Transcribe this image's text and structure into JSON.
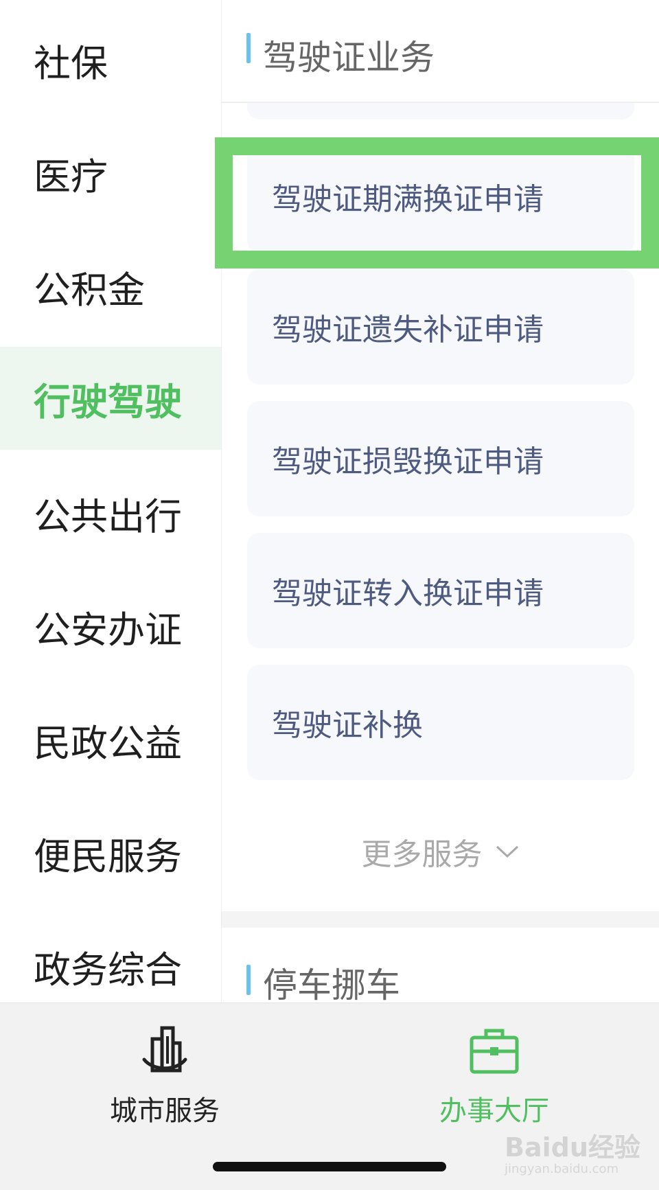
{
  "sidebar": {
    "items": [
      {
        "label": "社保"
      },
      {
        "label": "医疗"
      },
      {
        "label": "公积金"
      },
      {
        "label": "行驶驾驶"
      },
      {
        "label": "公共出行"
      },
      {
        "label": "公安办证"
      },
      {
        "label": "民政公益"
      },
      {
        "label": "便民服务"
      },
      {
        "label": "政务综合"
      }
    ],
    "active_label": "行驶驾驶"
  },
  "main": {
    "section1": {
      "title": "驾驶证业务",
      "services": [
        {
          "label": "驾驶证期满换证申请"
        },
        {
          "label": "驾驶证遗失补证申请"
        },
        {
          "label": "驾驶证损毁换证申请"
        },
        {
          "label": "驾驶证转入换证申请"
        },
        {
          "label": "驾驶证补换"
        }
      ],
      "more_label": "更多服务",
      "more_icon": "chevron-down-icon"
    },
    "section2": {
      "title": "停车挪车"
    }
  },
  "tabbar": {
    "tabs": [
      {
        "label": "城市服务",
        "icon": "city-buildings-icon",
        "color": "#222222"
      },
      {
        "label": "办事大厅",
        "icon": "briefcase-icon",
        "color": "#4fbf5f"
      }
    ]
  },
  "watermark": {
    "brand": "Baidu经验",
    "url": "jingyan.baidu.com"
  },
  "colors": {
    "accent_green": "#4fbf5f",
    "highlight_border": "#76d372",
    "section_bar_blue": "#69c3f2",
    "card_text": "#4e5a80",
    "card_bg": "#f7f8fb"
  }
}
